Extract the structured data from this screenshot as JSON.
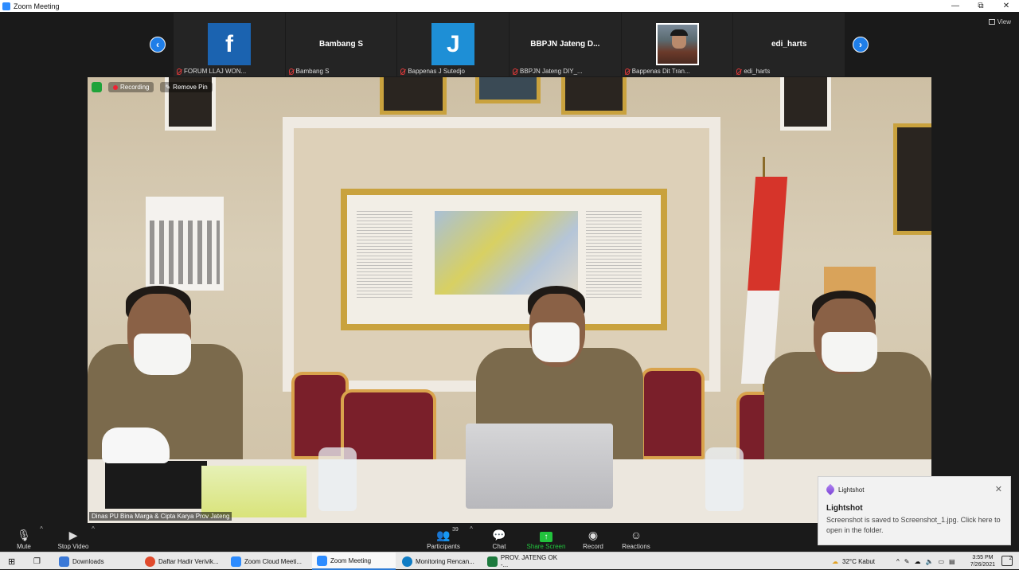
{
  "window": {
    "title": "Zoom Meeting",
    "controls": [
      "—",
      "⧉",
      "✕"
    ]
  },
  "view_button": {
    "label": "View"
  },
  "gallery": {
    "tiles": [
      {
        "big_text": "f",
        "kind": "facebook",
        "label": "FORUM LLAJ WON..."
      },
      {
        "big_text": "Bambang S",
        "kind": "name",
        "label": "Bambang S"
      },
      {
        "big_text": "J",
        "kind": "letter",
        "label": "Bappenas J Sutedjo"
      },
      {
        "big_text": "BBPJN Jateng D...",
        "kind": "name",
        "label": "BBPJN Jateng DIY_..."
      },
      {
        "big_text": "",
        "kind": "photo",
        "label": "Bappenas Dit Tran..."
      },
      {
        "big_text": "edi_harts",
        "kind": "name",
        "label": "edi_harts"
      }
    ],
    "prev_arrow": "‹",
    "next_arrow": "›"
  },
  "video": {
    "recording_label": "Recording",
    "remove_pin_label": "Remove Pin",
    "speaker_name": "Dinas PU Bina Marga & Cipta Karya Prov Jateng"
  },
  "toolbar": {
    "mute": "Mute",
    "stop_video": "Stop Video",
    "participants": "Participants",
    "participants_count": "39",
    "chat": "Chat",
    "share_screen": "Share Screen",
    "record": "Record",
    "reactions": "Reactions"
  },
  "toast": {
    "app": "Lightshot",
    "title": "Lightshot",
    "message": "Screenshot is saved to Screenshot_1.jpg. Click here to open in the folder.",
    "close": "✕"
  },
  "taskbar": {
    "items": [
      {
        "label": "Downloads",
        "color": "#3a78d6"
      },
      {
        "label": "Daftar Hadir Verivik...",
        "color": "#e04a2c"
      },
      {
        "label": "Zoom Cloud Meeti...",
        "color": "#2d8cff"
      },
      {
        "label": "Zoom Meeting",
        "color": "#2d8cff"
      },
      {
        "label": "Monitoring Rencan...",
        "color": "#0f7cc4"
      },
      {
        "label": "PROV. JATENG OK -...",
        "color": "#1d7a3e"
      }
    ],
    "weather": "32°C  Kabut",
    "time": "3:55 PM",
    "date": "7/26/2021",
    "notif_count": "2"
  },
  "colors": {
    "zoom_blue": "#2d8cff",
    "share_green": "#22c33d",
    "recording_red": "#e23333"
  }
}
